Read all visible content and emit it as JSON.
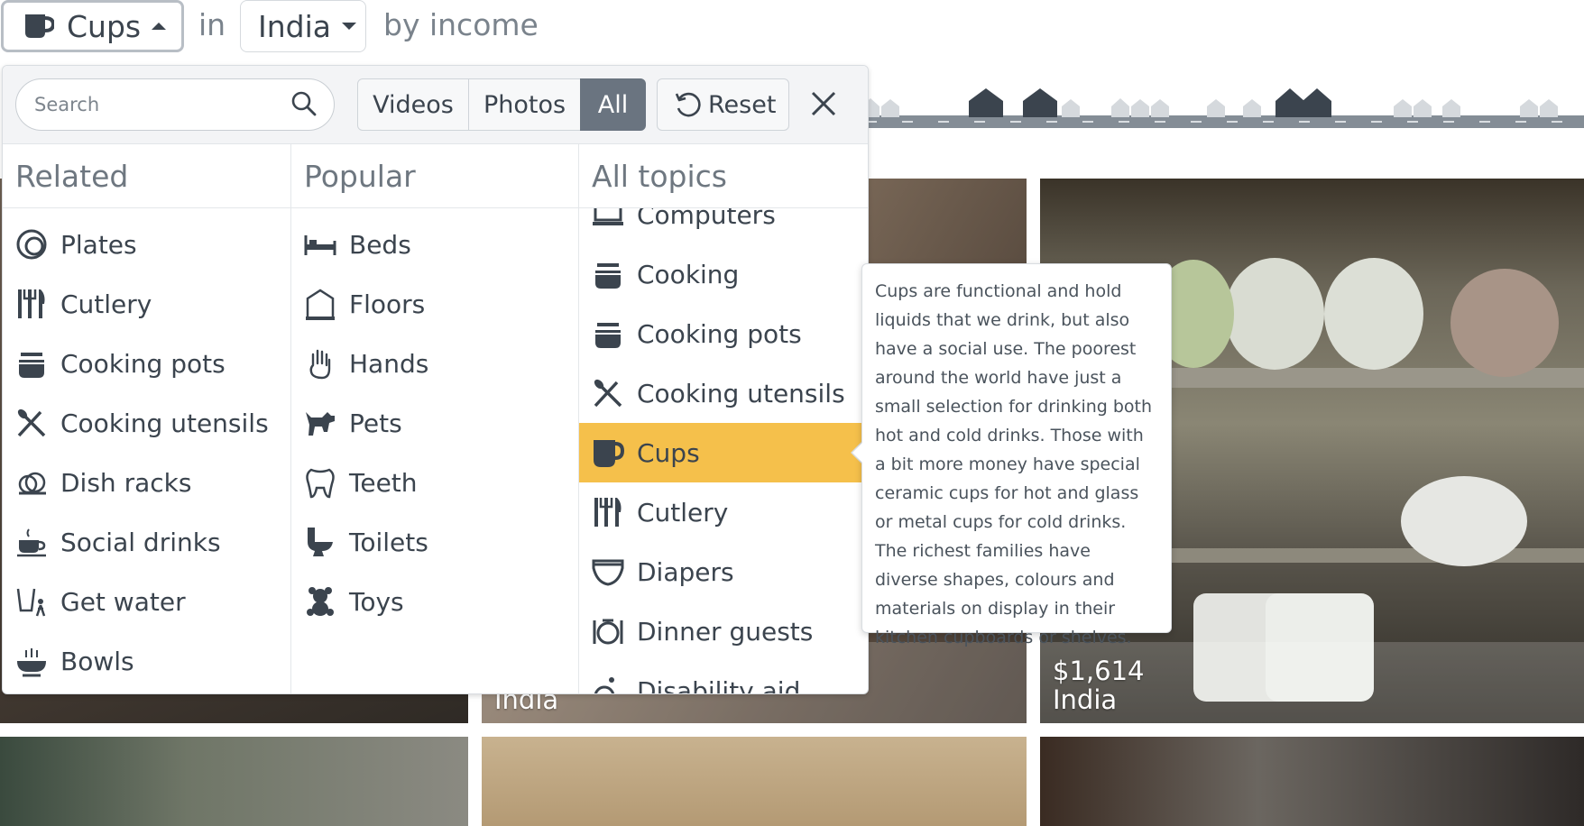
{
  "header": {
    "topic_label": "Cups",
    "in_label": "in",
    "country_label": "India",
    "by_label": "by income"
  },
  "panel": {
    "search_placeholder": "Search",
    "filters": [
      {
        "label": "Videos",
        "active": false
      },
      {
        "label": "Photos",
        "active": false
      },
      {
        "label": "All",
        "active": true
      }
    ],
    "reset_label": "Reset",
    "columns": {
      "related": {
        "title": "Related",
        "items": [
          {
            "label": "Plates",
            "icon": "plate-icon"
          },
          {
            "label": "Cutlery",
            "icon": "cutlery-icon"
          },
          {
            "label": "Cooking pots",
            "icon": "cooking-pot-icon"
          },
          {
            "label": "Cooking utensils",
            "icon": "cooking-utensils-icon"
          },
          {
            "label": "Dish racks",
            "icon": "dish-rack-icon"
          },
          {
            "label": "Social drinks",
            "icon": "social-drink-icon"
          },
          {
            "label": "Get water",
            "icon": "get-water-icon"
          },
          {
            "label": "Bowls",
            "icon": "bowl-icon"
          }
        ]
      },
      "popular": {
        "title": "Popular",
        "items": [
          {
            "label": "Beds",
            "icon": "bed-icon"
          },
          {
            "label": "Floors",
            "icon": "floor-icon"
          },
          {
            "label": "Hands",
            "icon": "hand-icon"
          },
          {
            "label": "Pets",
            "icon": "pet-icon"
          },
          {
            "label": "Teeth",
            "icon": "tooth-icon"
          },
          {
            "label": "Toilets",
            "icon": "toilet-icon"
          },
          {
            "label": "Toys",
            "icon": "toy-icon"
          }
        ]
      },
      "all_topics": {
        "title": "All topics",
        "items": [
          {
            "label": "Computers",
            "icon": "computer-icon"
          },
          {
            "label": "Cooking",
            "icon": "cooking-icon"
          },
          {
            "label": "Cooking pots",
            "icon": "cooking-pot-icon"
          },
          {
            "label": "Cooking utensils",
            "icon": "cooking-utensils-icon"
          },
          {
            "label": "Cups",
            "icon": "cup-icon",
            "active": true
          },
          {
            "label": "Cutlery",
            "icon": "cutlery-icon"
          },
          {
            "label": "Diapers",
            "icon": "diaper-icon"
          },
          {
            "label": "Dinner guests",
            "icon": "dinner-guests-icon"
          },
          {
            "label": "Disability aid",
            "icon": "disability-aid-icon"
          }
        ]
      }
    }
  },
  "tooltip": {
    "text": "Cups are functional and hold liquids that we drink, but also have a social use. The poorest around the world have just a small selection for drinking both hot and cold drinks. Those with a bit more money have special ceramic cups for hot and glass or metal cups for cold drinks. The richest families have diverse shapes, colours and materials on display in their kitchen cupboards or shelves."
  },
  "photos": [
    {
      "income": "",
      "country": "India"
    },
    {
      "income": "$1,614",
      "country": "India"
    }
  ],
  "colors": {
    "active_item": "#f5c04b",
    "all_filter": "#6a7480",
    "text": "#3b444e"
  }
}
